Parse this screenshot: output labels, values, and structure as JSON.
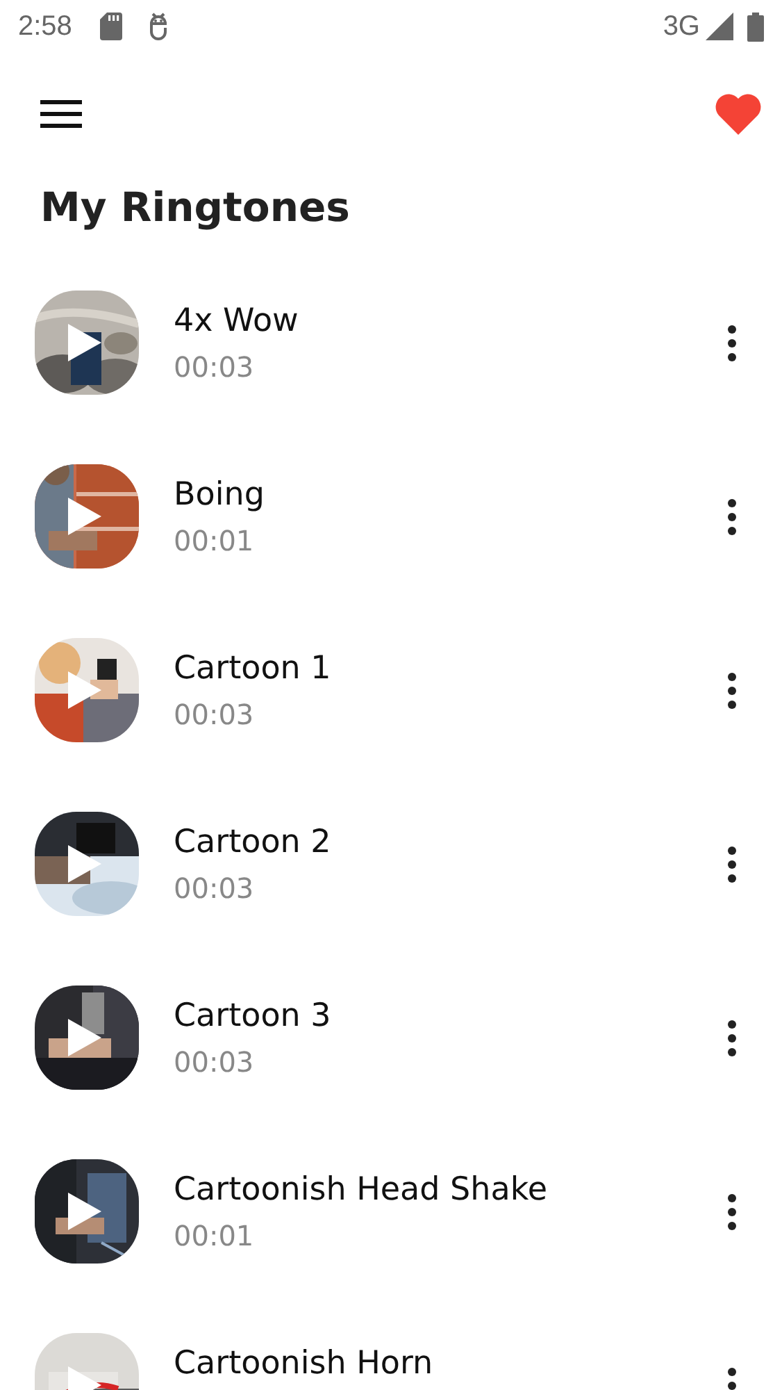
{
  "status_bar": {
    "time": "2:58",
    "network": "3G"
  },
  "app_bar": {
    "title": "My Ringtones"
  },
  "ringtones": [
    {
      "name": "4x Wow",
      "duration": "00:03"
    },
    {
      "name": "Boing",
      "duration": "00:01"
    },
    {
      "name": "Cartoon 1",
      "duration": "00:03"
    },
    {
      "name": "Cartoon 2",
      "duration": "00:03"
    },
    {
      "name": "Cartoon 3",
      "duration": "00:03"
    },
    {
      "name": "Cartoonish Head Shake",
      "duration": "00:01"
    },
    {
      "name": "Cartoonish Horn"
    }
  ]
}
